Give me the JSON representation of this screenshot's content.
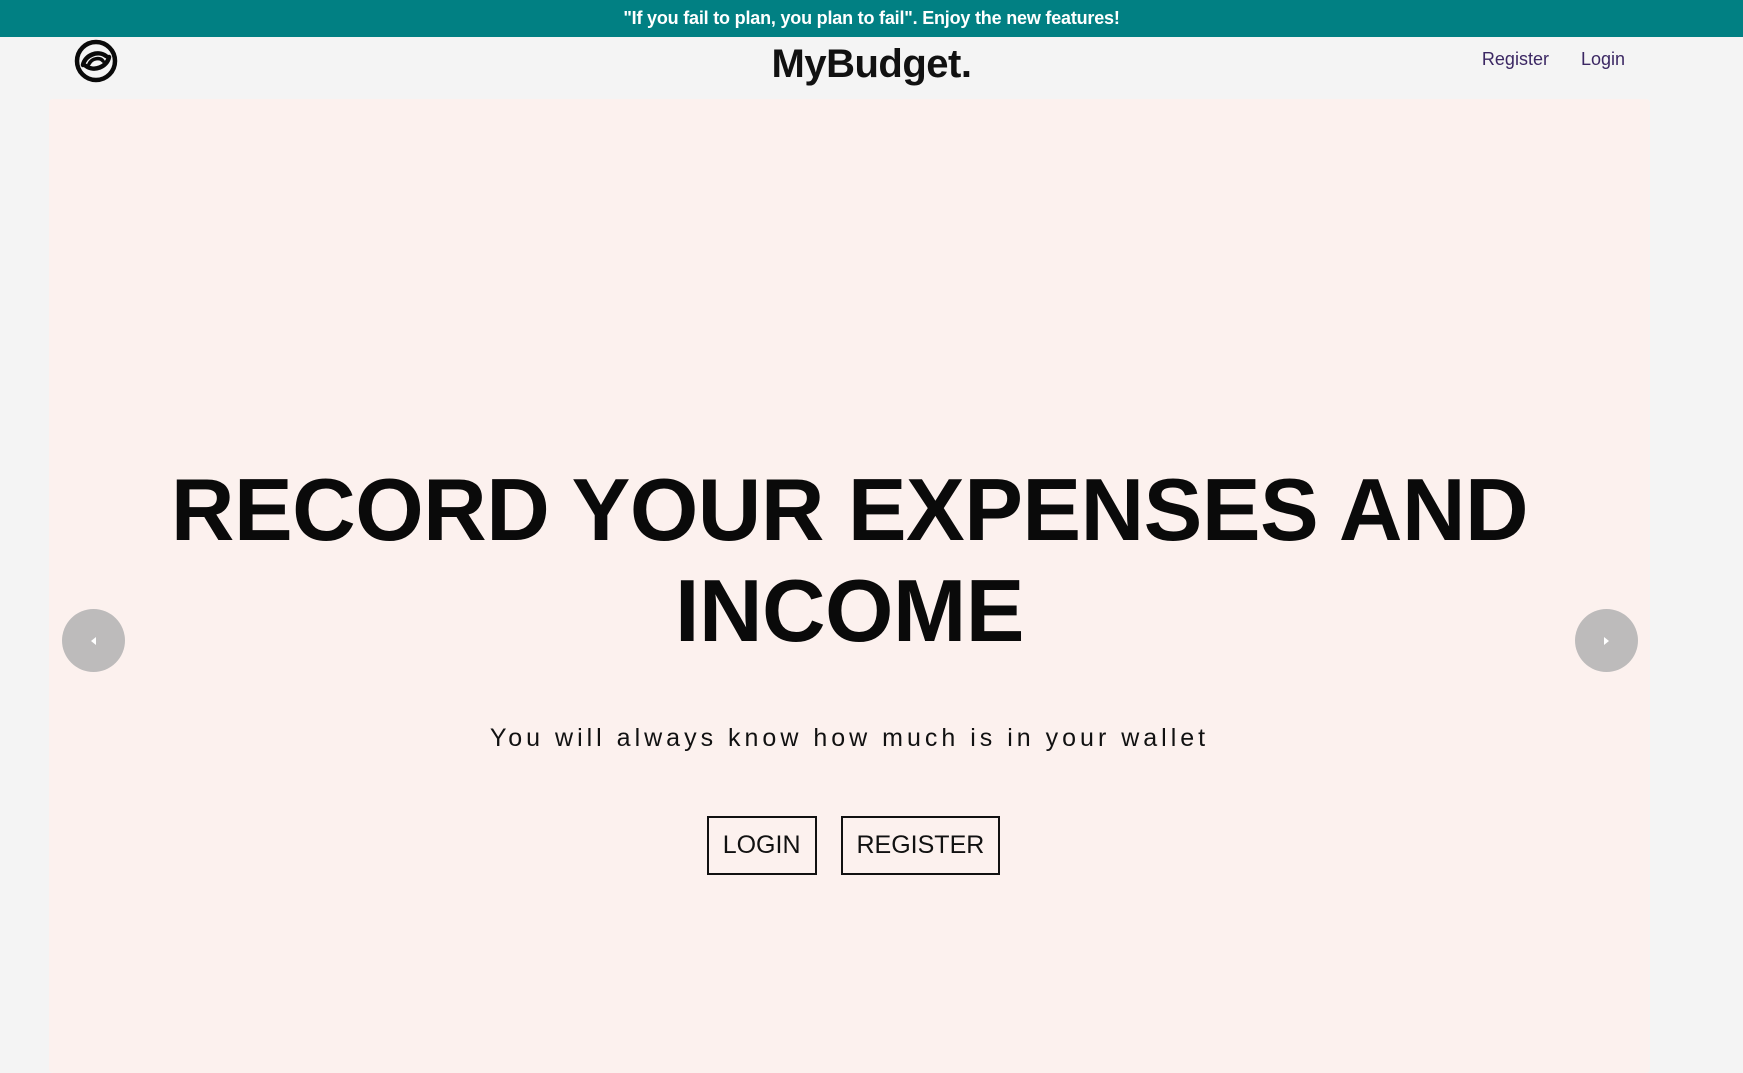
{
  "announcement": {
    "text": "\"If you fail to plan, you plan to fail\". Enjoy the new features!"
  },
  "header": {
    "brand": "MyBudget.",
    "logo_icon": "swirl-logo-icon",
    "nav": {
      "register_label": "Register",
      "login_label": "Login"
    }
  },
  "hero": {
    "title": "RECORD YOUR EXPENSES AND INCOME",
    "subtitle": "You will always know how much is in your wallet",
    "login_button": "LOGIN",
    "register_button": "REGISTER",
    "prev_icon": "chevron-left-icon",
    "next_icon": "chevron-right-icon"
  },
  "colors": {
    "announcement_bg": "#018083",
    "hero_bg": "#fcf1ee",
    "page_bg": "#f4f4f4",
    "nav_link": "#3b2763",
    "carousel_arrow_bg": "#bdbbbb"
  }
}
